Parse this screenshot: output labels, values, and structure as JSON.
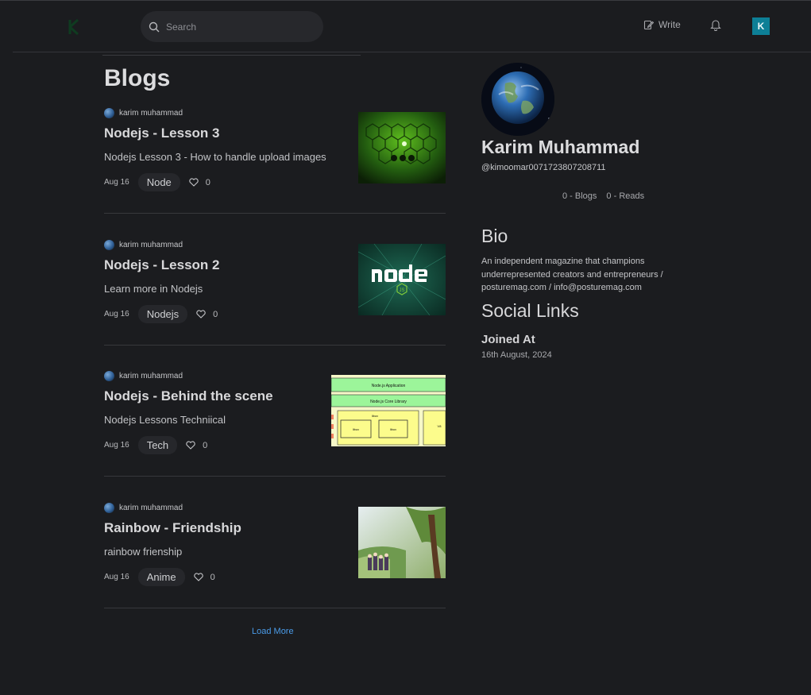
{
  "header": {
    "search": {
      "placeholder": "Search"
    },
    "write_label": "Write",
    "avatar_initial": "K"
  },
  "page": {
    "title": "Blogs"
  },
  "posts": [
    {
      "author": "karim muhammad",
      "title": "Nodejs - Lesson 3",
      "description": "Nodejs Lesson 3 - How to handle upload images",
      "date": "Aug 16",
      "tag": "Node",
      "likes": "0"
    },
    {
      "author": "karim muhammad",
      "title": "Nodejs - Lesson 2",
      "description": "Learn more in Nodejs",
      "date": "Aug 16",
      "tag": "Nodejs",
      "likes": "0"
    },
    {
      "author": "karim muhammad",
      "title": "Nodejs - Behind the scene",
      "description": "Nodejs Lessons Techniical",
      "date": "Aug 16",
      "tag": "Tech",
      "likes": "0",
      "diagram": {
        "app": "Node.js Application",
        "core": "Node.js Core Library",
        "box1": "libuv",
        "box2": "libuv",
        "box3": "libuv",
        "v8": "V8"
      }
    },
    {
      "author": "karim muhammad",
      "title": "Rainbow - Friendship",
      "description": "rainbow frienship",
      "date": "Aug 16",
      "tag": "Anime",
      "likes": "0"
    }
  ],
  "load_more_label": "Load More",
  "profile": {
    "name": "Karim Muhammad",
    "handle": "@kimoomar0071723807208711",
    "blogs_stat": "0 - Blogs",
    "reads_stat": "0 - Reads",
    "bio_heading": "Bio",
    "bio_text": "An independent magazine that champions underrepresented creators and entrepreneurs / posturemag.com / info@posturemag.com",
    "social_heading": "Social Links",
    "joined_heading": "Joined At",
    "joined_date": "16th August, 2024"
  },
  "colors": {
    "background": "#1b1c1f",
    "accent_link": "#4a9be8",
    "avatar_bg": "#0d7f96"
  }
}
